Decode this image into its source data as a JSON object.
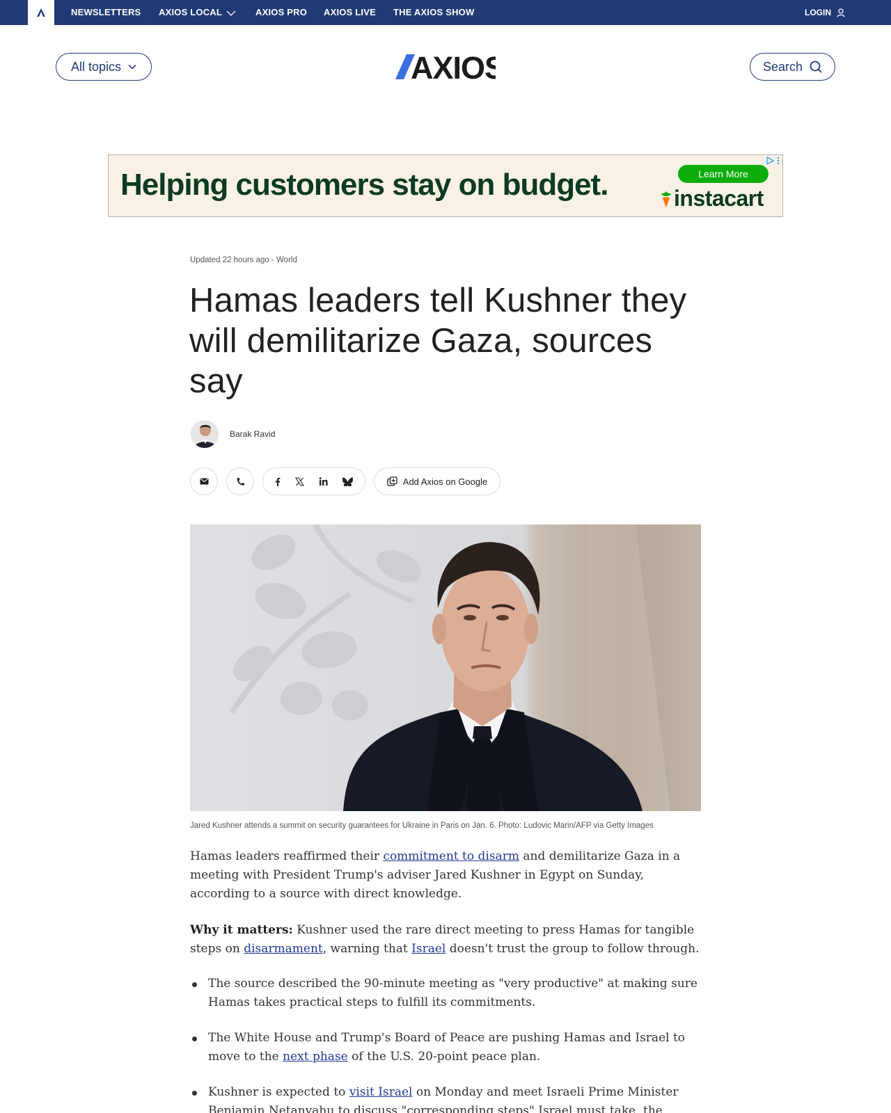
{
  "topnav": {
    "items": [
      {
        "label": "NEWSLETTERS"
      },
      {
        "label": "AXIOS LOCAL"
      },
      {
        "label": "AXIOS PRO"
      },
      {
        "label": "AXIOS LIVE"
      },
      {
        "label": "THE AXIOS SHOW"
      }
    ],
    "login_label": "LOGIN"
  },
  "header": {
    "topics_label": "All topics",
    "brand": "AXIOS",
    "search_label": "Search"
  },
  "ad": {
    "headline": "Helping customers stay on budget.",
    "cta": "Learn More",
    "brand": "instacart"
  },
  "article": {
    "meta": "Updated 22 hours ago - World",
    "headline": "Hamas leaders tell Kushner they will demilitarize Gaza, sources say",
    "author": "Barak Ravid",
    "google_button": "Add Axios on Google",
    "caption": "Jared Kushner attends a summit on security guarantees for Ukraine in Paris on Jan. 6. Photo: Ludovic Marin/AFP via Getty Images",
    "p1": {
      "a": "Hamas leaders reaffirmed their ",
      "link": "commitment to disarm",
      "b": " and demilitarize Gaza in a meeting with President Trump's adviser Jared Kushner in Egypt on Sunday, according to a source with direct knowledge."
    },
    "p2": {
      "lead": "Why it matters:",
      "a": " Kushner used the rare direct meeting to press Hamas for tangible steps on ",
      "link1": "disarmament",
      "b": ", warning that ",
      "link2": "Israel",
      "c": " doesn't trust the group to follow through."
    },
    "bullets": [
      {
        "a": "The source described the 90-minute meeting as \"very productive\" at making sure Hamas takes practical steps to fulfill its commitments.",
        "link": "",
        "b": ""
      },
      {
        "a": "The White House and Trump's Board of Peace are pushing Hamas and Israel to move to the ",
        "link": "next phase",
        "b": " of the U.S. 20-point peace plan."
      },
      {
        "a": "Kushner is expected to ",
        "link": "visit Israel",
        "b": " on Monday and meet Israeli Prime Minister Benjamin Netanyahu to discuss \"corresponding steps\" Israel must take, the source said."
      }
    ]
  },
  "colors": {
    "nav_bg": "#203a75",
    "link": "#203a95",
    "ad_bg": "#faf1e6",
    "ad_green": "#0aad0a"
  }
}
